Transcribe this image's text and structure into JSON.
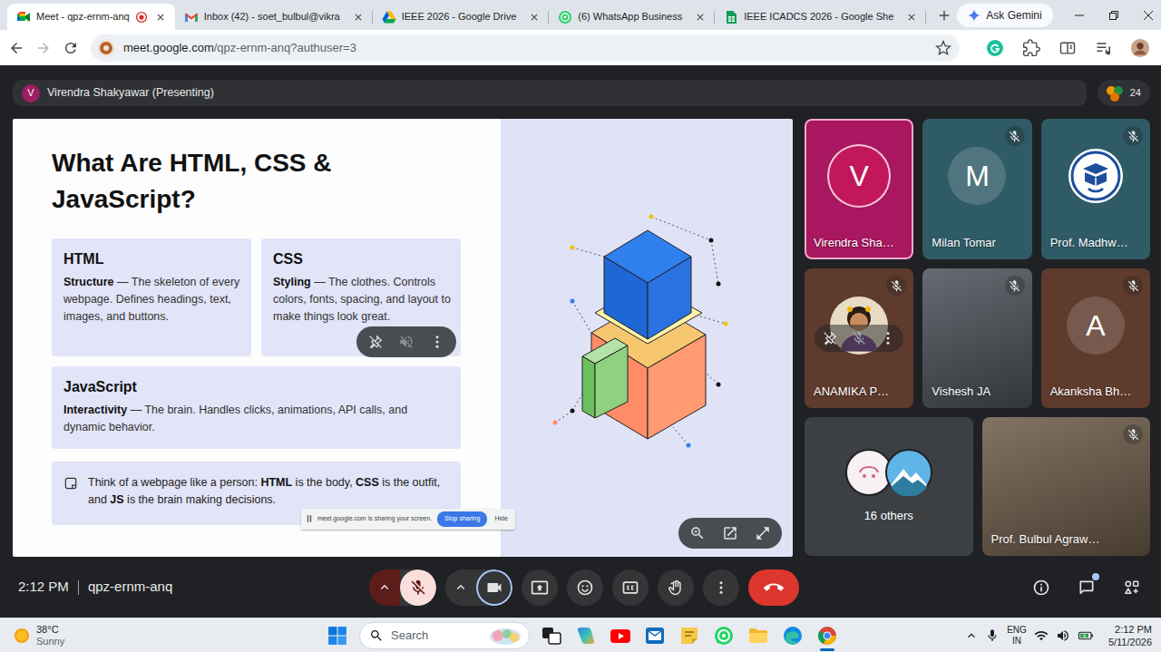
{
  "browser": {
    "tabs": [
      {
        "title": "Meet - qpz-ernm-anq",
        "selected": true,
        "recording": true
      },
      {
        "title": "Inbox (42) - soet_bulbul@vikra",
        "selected": false,
        "recording": false
      },
      {
        "title": "IEEE 2026 - Google Drive",
        "selected": false,
        "recording": false
      },
      {
        "title": "(6) WhatsApp Business",
        "selected": false,
        "recording": false
      },
      {
        "title": "IEEE ICADCS 2026 - Google She",
        "selected": false,
        "recording": false
      }
    ],
    "gemini_button": "Ask Gemini",
    "address": {
      "host": "meet.google.com",
      "path": "/qpz-ernm-anq?authuser=3",
      "bookmarked": false
    }
  },
  "meet": {
    "presenter": {
      "initial": "V",
      "label": "Virendra Shakyawar (Presenting)"
    },
    "participant_count": "24",
    "stage_hovered": true,
    "slide": {
      "title": "What Are HTML, CSS & JavaScript?",
      "cards": [
        {
          "heading": "HTML",
          "lead": "Structure",
          "text": " — The skeleton of every webpage. Defines headings, text, images, and buttons."
        },
        {
          "heading": "CSS",
          "lead": "Styling",
          "text": " — The clothes. Controls colors, fonts, spacing, and layout to make things look great."
        },
        {
          "heading": "JavaScript",
          "lead": "Interactivity",
          "text": " — The brain. Handles clicks, animations, API calls, and dynamic behavior."
        }
      ],
      "callout": [
        {
          "text": "Think of a webpage like a person: ",
          "bold": false
        },
        {
          "text": "HTML",
          "bold": true
        },
        {
          "text": " is the body, ",
          "bold": false
        },
        {
          "text": "CSS",
          "bold": true
        },
        {
          "text": " is the outfit, and ",
          "bold": false
        },
        {
          "text": "JS",
          "bold": true
        },
        {
          "text": " is the brain making decisions.",
          "bold": false
        }
      ]
    },
    "share_notice": {
      "text": "meet.google.com is sharing your screen.",
      "stop": "Stop sharing",
      "hide": "Hide"
    },
    "tiles": [
      {
        "name": "Virendra Sha…",
        "kind": "avatar",
        "initial": "V",
        "color": "#a8175f",
        "muted": false,
        "speaking": true,
        "hovered": false
      },
      {
        "name": "Milan Tomar",
        "kind": "avatar",
        "initial": "M",
        "color": "#2f5b66",
        "muted": true,
        "speaking": false,
        "hovered": false
      },
      {
        "name": "Prof. Madhw…",
        "kind": "logo",
        "color": "#2f5b66",
        "muted": true,
        "speaking": false,
        "hovered": false
      },
      {
        "name": "ANAMIKA P…",
        "kind": "photo",
        "color": "#5e3b2c",
        "muted": true,
        "speaking": false,
        "hovered": true
      },
      {
        "name": "Vishesh JA",
        "kind": "video",
        "color": "#4c535a",
        "muted": true,
        "speaking": false,
        "hovered": false
      },
      {
        "name": "Akanksha Bh…",
        "kind": "avatar",
        "initial": "A",
        "color": "#5e3b2c",
        "muted": true,
        "speaking": false,
        "hovered": false
      },
      {
        "name": "16 others",
        "kind": "others",
        "color": "#3c4043",
        "muted": false,
        "speaking": false,
        "hovered": false
      },
      {
        "name": "Prof. Bulbul Agraw…",
        "kind": "video",
        "color": "#6e5c49",
        "muted": true,
        "speaking": false,
        "hovered": false
      }
    ],
    "footer": {
      "time": "2:12 PM",
      "code": "qpz-ernm-anq",
      "mic_muted": true,
      "camera_on": true,
      "chat_unread": true
    }
  },
  "taskbar": {
    "weather": {
      "temp": "38°C",
      "condition": "Sunny"
    },
    "search": "Search",
    "apps": [
      {
        "active": false
      },
      {
        "active": false
      },
      {
        "active": false
      },
      {
        "active": false
      },
      {
        "active": false
      },
      {
        "active": false
      },
      {
        "active": false
      },
      {
        "active": false
      },
      {
        "active": true
      }
    ],
    "language": {
      "lang": "ENG",
      "region": "IN"
    },
    "time": "2:12 PM",
    "date": "5/11/2026"
  }
}
